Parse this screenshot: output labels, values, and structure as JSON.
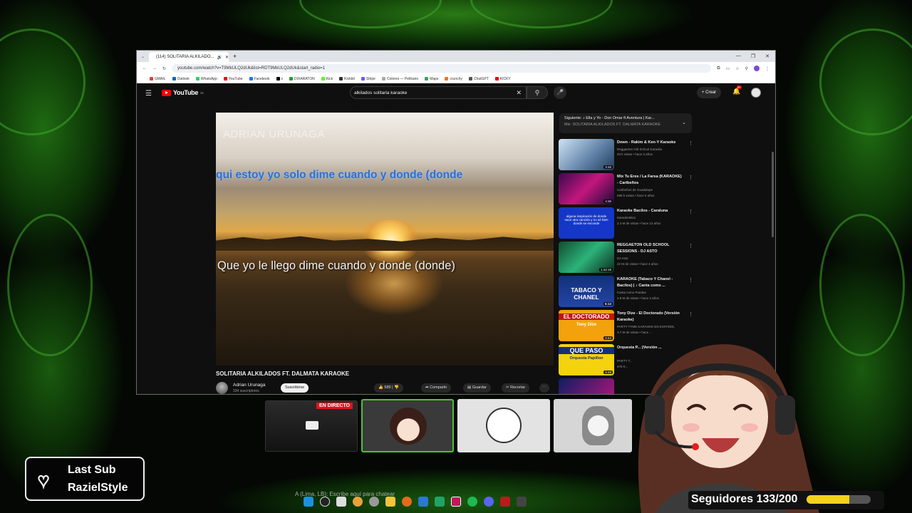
{
  "browser": {
    "tab_title": "(114) SOLITARIA ALKILADO...",
    "url": "youtube.com/watch?v=T9MkULQ2dUk&list=RDT9MkULQ2dUk&start_radio=1",
    "bookmarks": [
      "GMAIL",
      "Outlook",
      "WhatsApp",
      "YouTube",
      "Facebook",
      "x",
      "DIXARATON",
      "Kick",
      "Kickbit",
      "Stripe",
      "Colores — Pelikano",
      "Maps",
      "crunchy",
      "ChatGPT",
      "KICKY"
    ]
  },
  "youtube": {
    "logo": "YouTube",
    "logo_sup": "PE",
    "search_value": "alkilados solitaria karaoke",
    "crear_label": "+ Crear",
    "notif_count": "9+"
  },
  "video": {
    "watermark": "ADRIAN URUNAGA",
    "lyric_top": "qui estoy yo solo dime cuando y donde (donde",
    "lyric_bottom": "Que yo le llego dime cuando y donde (donde)",
    "title": "SOLITARIA ALKILADOS FT. DALMATA KARAOKE",
    "channel": "Adrian Urunaga",
    "subs": "334 suscriptores",
    "subscribe_label": "Suscribirse",
    "likes": "589",
    "share_label": "Compartir",
    "save_label": "Guardar",
    "clip_label": "Recortar"
  },
  "next_up": {
    "line1": "Siguiente: ♪ Ella y Yo - Don Omar ft Aventura | Kar...",
    "line2": "Mix: SOLITARIA ALKILADOS FT. DALMATA KARAOKE"
  },
  "playlist": [
    {
      "title": "Down - Rakim & Ken-Y Karaoke",
      "channel": "Reggaeton Old School Karaoke",
      "meta": "20 k vistas • hace 3 años",
      "duration": "3:46"
    },
    {
      "title": "Mix Tu Eres / La Farsa (KARAOKE) - Caribeños",
      "channel": "Caribeños de Guadalupe",
      "meta": "598 k vistas • hace 5 años",
      "duration": "4:36"
    },
    {
      "title": "Karaoke Bacilos - Caraluna",
      "channel": "KaraokeMix1",
      "meta": "2.4 M de vistas • hace 13 años",
      "duration": ""
    },
    {
      "title": "REGGAETON OLD SCHOOL SESSIONS - DJ ASTO",
      "channel": "DJ Asto",
      "meta": "22 M de vistas • hace 4 años",
      "duration": "1:44:18"
    },
    {
      "title": "KARAOKE (Tabaco Y Chanel - Bacilos) | ♪ Canta como ...",
      "channel": "Canta como Puedas",
      "meta": "2.8 M de vistas • hace 3 años",
      "duration": "5:13"
    },
    {
      "title": "Tony Dize - El Doctorado (Versión Karaoke)",
      "channel": "PARTY TYME KARAOKE EN ESPAÑOL",
      "meta": "3.7 M de vistas • hace ...",
      "duration": "4:44"
    },
    {
      "title": "Orquesta P... (Versión ...",
      "channel": "PARTY T...",
      "meta": "476 K...",
      "duration": "4:48"
    }
  ],
  "thumb_text": {
    "tabaco": "TABACO Y CHANEL",
    "doctorado": "EL DOCTORADO",
    "tony": "Tony Dize",
    "quepaso": "QUE PASO",
    "orquesta": "Orquesta Papillon",
    "bacilos": "alguna inspiración de donde nace otra canción y no sé bien donde se esconde"
  },
  "stream": {
    "live_label": "EN DIRECTO",
    "last_sub_title": "Last Sub",
    "last_sub_name": "RazielStyle",
    "followers_label": "Seguidores 133/200",
    "followers_progress": 0.665,
    "chat_hint": "A (Lima, LB): Escribe aquí para chatear"
  },
  "colors": {
    "frame_green": "#3fa52a",
    "yt_red": "#ff0000",
    "live_red": "#e0141b",
    "progress_yellow": "#f4d21a"
  }
}
